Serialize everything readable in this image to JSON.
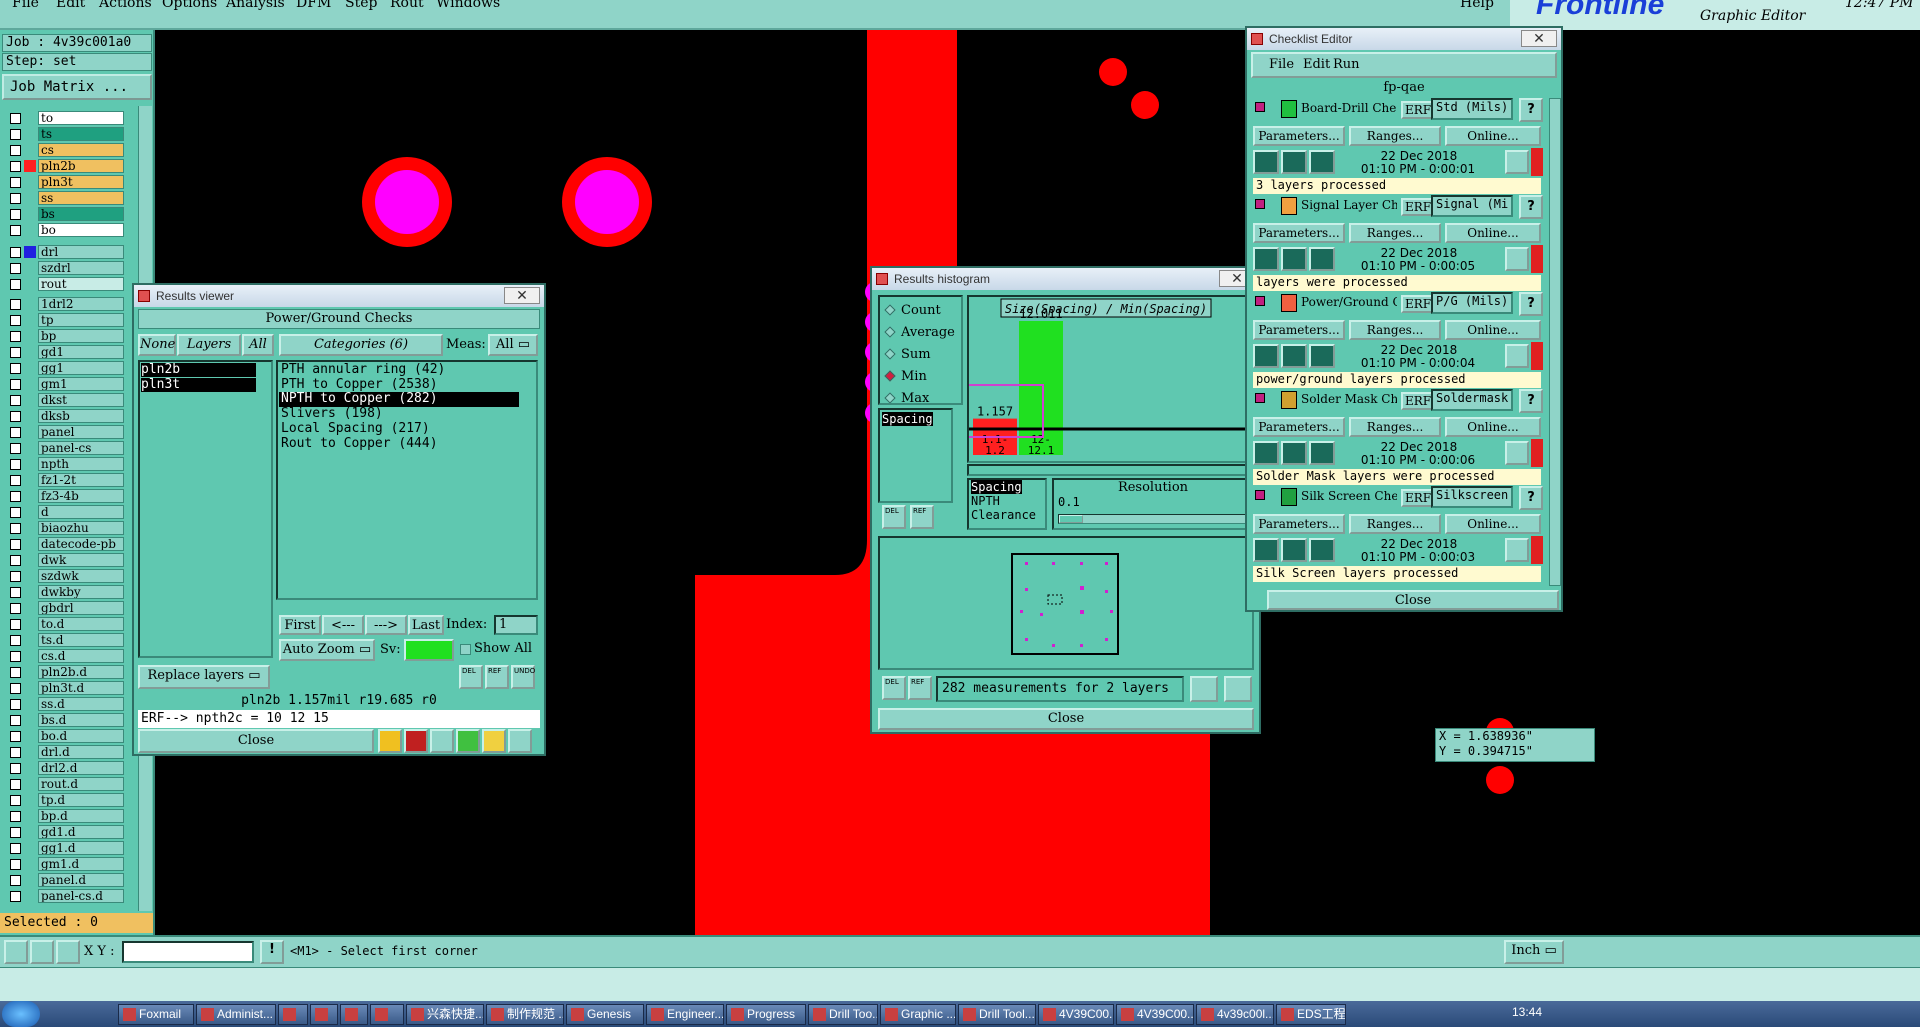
{
  "menubar": {
    "items": [
      "File",
      "Edit",
      "Actions",
      "Options",
      "Analysis",
      "DFM",
      "Step",
      "Rout",
      "Windows"
    ],
    "help": "Help"
  },
  "logo": {
    "brand": "Frontline",
    "subtitle": "Graphic Editor",
    "time": "12:47 PM"
  },
  "leftpanel": {
    "job": "Job : 4v39c001a0",
    "step": "Step: set",
    "job_matrix": "Job Matrix ...",
    "selected": "Selected : 0",
    "layers_a": [
      {
        "name": "to",
        "color": "#ffffff"
      },
      {
        "name": "ts",
        "color": "#1fa080"
      },
      {
        "name": "cs",
        "color": "#f0c060"
      },
      {
        "name": "pln2b",
        "color": "#f0c060",
        "active": true
      },
      {
        "name": "pln3t",
        "color": "#f0c060"
      },
      {
        "name": "ss",
        "color": "#f0c060"
      },
      {
        "name": "bs",
        "color": "#1fa080"
      },
      {
        "name": "bo",
        "color": "#ffffff"
      }
    ],
    "layers_b": [
      {
        "name": "drl",
        "color": "#8fd4c8"
      },
      {
        "name": "szdrl",
        "color": "#8fd4c8"
      },
      {
        "name": "rout",
        "color": "#c8ece6"
      }
    ],
    "layers_c": [
      "1drl2",
      "tp",
      "bp",
      "gd1",
      "gg1",
      "gm1",
      "dkst",
      "dksb",
      "panel",
      "panel-cs",
      "npth",
      "fz1-2t",
      "fz3-4b",
      "d",
      "biaozhu",
      "datecode-pb",
      "dwk",
      "szdwk",
      "dwkby",
      "gbdrl",
      "to.d",
      "ts.d",
      "cs.d",
      "pln2b.d",
      "pln3t.d",
      "ss.d",
      "bs.d",
      "bo.d",
      "drl.d",
      "drl2.d",
      "rout.d",
      "tp.d",
      "bp.d",
      "gd1.d",
      "gg1.d",
      "gm1.d",
      "panel.d",
      "panel-cs.d"
    ]
  },
  "results_viewer": {
    "title": "Results viewer",
    "header": "Power/Ground Checks",
    "none_btn": "None",
    "layers_label": "Layers",
    "all_btn": "All",
    "categories_label": "Categories (6)",
    "meas_label": "Meas:",
    "meas_value": "All",
    "layers": [
      "pln2b",
      "pln3t"
    ],
    "categories": [
      "PTH annular ring (42)",
      "PTH to Copper (2538)",
      "NPTH to Copper (282)",
      "Slivers (198)",
      "Local Spacing (217)",
      "Rout to Copper (444)"
    ],
    "selected_category": 2,
    "first_btn": "First",
    "prev_btn": "<---",
    "next_btn": "--->",
    "last_btn": "Last",
    "index_label": "Index:",
    "index_value": "1",
    "auto_zoom": "Auto Zoom",
    "sv_label": "Sv:",
    "show_all": "Show All",
    "replace_layers": "Replace layers",
    "status_line": "pln2b 1.157mil  r19.685  r0",
    "erf_line": "ERF--> npth2c = 10 12 15",
    "close": "Close",
    "del_label": "DEL",
    "ref_label": "REF",
    "undo_label": "UNDO"
  },
  "histogram": {
    "title": "Results histogram",
    "stats": [
      "Count",
      "Average",
      "Sum",
      "Min",
      "Max"
    ],
    "selected_stat": "Min",
    "graph_title": "Size(Spacing) / Min(Spacing)",
    "measure_list_top": [
      "Spacing"
    ],
    "measure_list": [
      "Spacing",
      "NPTH",
      "Clearance"
    ],
    "resolution_label": "Resolution",
    "resolution_value": "0.1",
    "footer": "282 measurements for 2 layers",
    "close": "Close",
    "del_label": "DEL",
    "ref_label": "REF"
  },
  "chart_data": {
    "type": "bar",
    "categories": [
      "1.1-1.2",
      "12-12.1"
    ],
    "values": [
      1.157,
      12.011
    ],
    "value_labels": [
      "1.157",
      "12.011"
    ],
    "category_labels": [
      [
        "1.1-",
        "1.2"
      ],
      [
        "12-",
        "12.1"
      ]
    ],
    "colors": [
      "#ff2020",
      "#20e020"
    ],
    "title": "Size(Spacing) / Min(Spacing)"
  },
  "checklist": {
    "title": "Checklist Editor",
    "menu": [
      "File",
      "Edit",
      "Run"
    ],
    "name": "fp-qae",
    "items": [
      {
        "label": "Board-Drill Che",
        "erf": "Std (Mils)",
        "date": "22 Dec 2018",
        "time": "01:10 PM - 0:00:01",
        "msg": "3 layers processed",
        "icon_color": "#20c040"
      },
      {
        "label": "Signal Layer Ch",
        "erf": "Signal (Mi",
        "date": "22 Dec 2018",
        "time": "01:10 PM - 0:00:05",
        "msg": "layers were processed",
        "icon_color": "#f0a040"
      },
      {
        "label": "Power/Ground C",
        "erf": "P/G (Mils)",
        "date": "22 Dec 2018",
        "time": "01:10 PM - 0:00:04",
        "msg": "power/ground layers processed",
        "icon_color": "#f06040"
      },
      {
        "label": "Solder Mask Ch",
        "erf": "Soldermask",
        "date": "22 Dec 2018",
        "time": "01:10 PM - 0:00:06",
        "msg": "Solder Mask layers were processed",
        "icon_color": "#d0a030"
      },
      {
        "label": "Silk Screen Che",
        "erf": "Silkscreen",
        "date": "22 Dec 2018",
        "time": "01:10 PM - 0:00:03",
        "msg": "Silk Screen layers processed",
        "icon_color": "#20a040"
      }
    ],
    "erf_label": "ERF:",
    "params": "Parameters...",
    "ranges": "Ranges...",
    "online": "Online...",
    "close": "Close"
  },
  "coords": {
    "x": "X = 1.638936\"",
    "y": "Y = 0.394715\""
  },
  "statusbar": {
    "xy_label": "X Y :",
    "xy_value": "",
    "prompt": "<M1> - Select first corner",
    "units": "Inch"
  },
  "taskbar": {
    "items": [
      "Foxmail",
      "Administ...",
      "",
      "",
      "",
      "",
      "兴森快捷...",
      "制作规范 ...",
      "Genesis",
      "Engineer...",
      "Progress",
      "Drill Too...",
      "Graphic ...",
      "Drill Tool...",
      "4V39C00...",
      "4V39C00...",
      "4v39c00l...",
      "EDS工程..."
    ],
    "clock": "13:44"
  }
}
